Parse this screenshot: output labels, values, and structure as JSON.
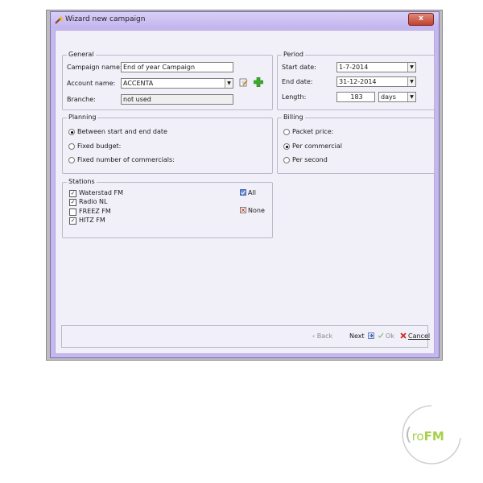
{
  "window": {
    "title": "Wizard new campaign",
    "close_glyph": "x"
  },
  "general": {
    "legend": "General",
    "campaign_name_label": "Campaign name:",
    "campaign_name_value": "End of year Campaign",
    "account_name_label": "Account name:",
    "account_name_value": "ACCENTA",
    "branche_label": "Branche:",
    "branche_value": "not used"
  },
  "period": {
    "legend": "Period",
    "start_label": "Start date:",
    "start_value": "1-7-2014",
    "end_label": "End date:",
    "end_value": "31-12-2014",
    "length_label": "Length:",
    "length_value": "183",
    "length_unit": "days"
  },
  "planning": {
    "legend": "Planning",
    "options": [
      "Between start and end date",
      "Fixed budget:",
      "Fixed number of commercials:"
    ],
    "selected": 0
  },
  "billing": {
    "legend": "Billing",
    "options": [
      "Packet price:",
      "Per commercial",
      "Per second"
    ],
    "selected": 1
  },
  "stations": {
    "legend": "Stations",
    "items": [
      {
        "label": "Waterstad FM",
        "checked": true
      },
      {
        "label": "Radio NL",
        "checked": true
      },
      {
        "label": "FREEZ FM",
        "checked": false
      },
      {
        "label": "HITZ FM",
        "checked": true
      }
    ],
    "all_label": "All",
    "none_label": "None"
  },
  "buttons": {
    "back": "Back",
    "next": "Next",
    "ok": "Ok",
    "cancel": "Cancel"
  },
  "logo": {
    "text_prefix": "ro",
    "text_suffix": "FM",
    "accent": "#a7d04a"
  },
  "colors": {
    "frame": "#c5b8ef",
    "client": "#f1f0f9"
  }
}
